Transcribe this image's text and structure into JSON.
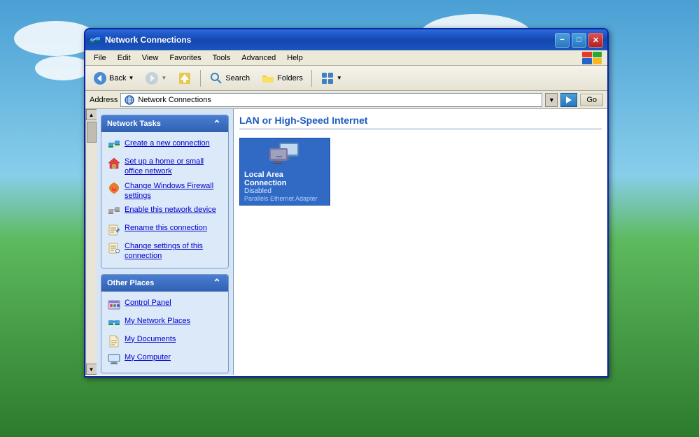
{
  "desktop": {},
  "window": {
    "title": "Network Connections",
    "icon": "🌐"
  },
  "title_bar_buttons": {
    "minimize": "−",
    "maximize": "□",
    "close": "✕"
  },
  "menu_bar": {
    "items": [
      "File",
      "Edit",
      "View",
      "Favorites",
      "Tools",
      "Advanced",
      "Help"
    ]
  },
  "toolbar": {
    "back_label": "Back",
    "search_label": "Search",
    "folders_label": "Folders"
  },
  "address_bar": {
    "label": "Address",
    "value": "Network Connections",
    "go_label": "Go"
  },
  "left_panel": {
    "network_tasks": {
      "header": "Network Tasks",
      "items": [
        {
          "id": "create-connection",
          "text": "Create a new connection"
        },
        {
          "id": "set-up-home",
          "text": "Set up a home or small office network"
        },
        {
          "id": "change-firewall",
          "text": "Change Windows Firewall settings"
        },
        {
          "id": "enable-device",
          "text": "Enable this network device"
        },
        {
          "id": "rename-connection",
          "text": "Rename this connection"
        },
        {
          "id": "change-settings",
          "text": "Change settings of this connection"
        }
      ]
    },
    "other_places": {
      "header": "Other Places",
      "items": [
        {
          "id": "control-panel",
          "text": "Control Panel"
        },
        {
          "id": "my-network",
          "text": "My Network Places"
        },
        {
          "id": "my-documents",
          "text": "My Documents"
        },
        {
          "id": "my-computer",
          "text": "My Computer"
        }
      ]
    }
  },
  "main_content": {
    "section_header": "LAN or High-Speed Internet",
    "connections": [
      {
        "id": "local-area-connection",
        "name": "Local Area Connection",
        "status": "Disabled",
        "adapter": "Parallels Ethernet Adapter"
      }
    ]
  },
  "colors": {
    "accent_blue": "#316ac5",
    "link_blue": "#0000cc",
    "task_header_bg": "#4a7fd4",
    "title_bar_start": "#2a6bdb",
    "close_btn": "#b02020"
  }
}
